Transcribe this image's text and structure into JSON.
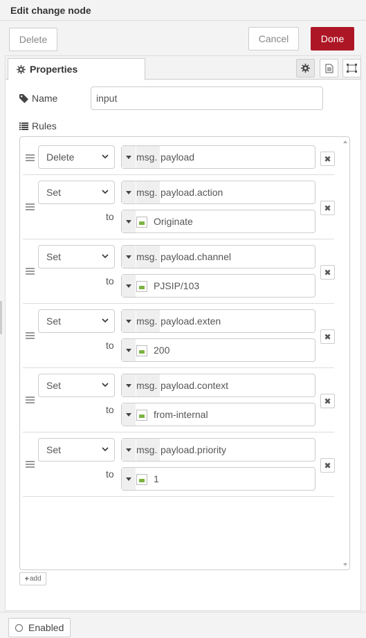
{
  "header": {
    "title": "Edit change node"
  },
  "toolbar": {
    "delete_label": "Delete",
    "cancel_label": "Cancel",
    "done_label": "Done",
    "done_color": "#ad1625"
  },
  "tabs": {
    "properties_label": "Properties"
  },
  "form": {
    "name_label": "Name",
    "name_value": "input",
    "rules_label": "Rules"
  },
  "rules": [
    {
      "action": "Delete",
      "prefix": "msg.",
      "property": "payload"
    },
    {
      "action": "Set",
      "prefix": "msg.",
      "property": "payload.action",
      "to_label": "to",
      "value": "Originate"
    },
    {
      "action": "Set",
      "prefix": "msg.",
      "property": "payload.channel",
      "to_label": "to",
      "value": "PJSIP/103"
    },
    {
      "action": "Set",
      "prefix": "msg.",
      "property": "payload.exten",
      "to_label": "to",
      "value": "200"
    },
    {
      "action": "Set",
      "prefix": "msg.",
      "property": "payload.context",
      "to_label": "to",
      "value": "from-internal"
    },
    {
      "action": "Set",
      "prefix": "msg.",
      "property": "payload.priority",
      "to_label": "to",
      "value": "1"
    }
  ],
  "add": {
    "label": "add"
  },
  "footer": {
    "enabled_label": "Enabled"
  }
}
